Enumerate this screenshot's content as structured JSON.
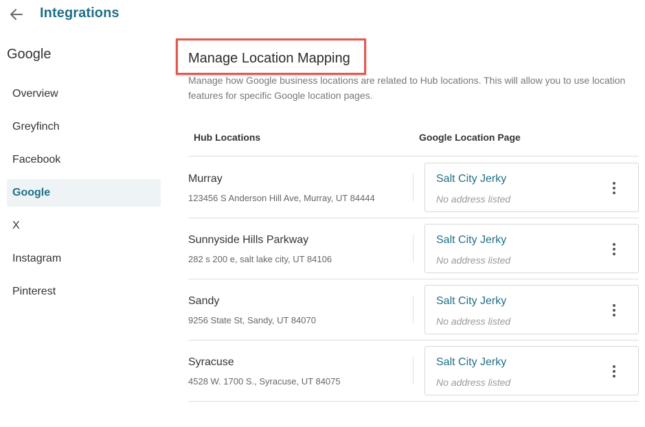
{
  "header": {
    "back_icon": "arrow-left-icon",
    "title": "Integrations"
  },
  "sidebar": {
    "heading": "Google",
    "items": [
      {
        "label": "Overview",
        "active": false
      },
      {
        "label": "Greyfinch",
        "active": false
      },
      {
        "label": "Facebook",
        "active": false
      },
      {
        "label": "Google",
        "active": true
      },
      {
        "label": "X",
        "active": false
      },
      {
        "label": "Instagram",
        "active": false
      },
      {
        "label": "Pinterest",
        "active": false
      }
    ]
  },
  "main": {
    "title": "Manage Location Mapping",
    "description": "Manage how Google business locations are related to Hub locations. This will allow you to use location features for specific Google location pages.",
    "columns": {
      "hub": "Hub Locations",
      "google": "Google Location Page"
    },
    "rows": [
      {
        "hub_name": "Murray",
        "hub_address": "123456 S Anderson Hill Ave, Murray, UT 84444",
        "google_name": "Salt City Jerky",
        "google_address": "No address listed"
      },
      {
        "hub_name": "Sunnyside Hills Parkway",
        "hub_address": "282 s 200 e, salt lake city, UT 84106",
        "google_name": "Salt City Jerky",
        "google_address": "No address listed"
      },
      {
        "hub_name": "Sandy",
        "hub_address": "9256 State St, Sandy, UT 84070",
        "google_name": "Salt City Jerky",
        "google_address": "No address listed"
      },
      {
        "hub_name": "Syracuse",
        "hub_address": "4528 W. 1700 S., Syracuse, UT 84075",
        "google_name": "Salt City Jerky",
        "google_address": "No address listed"
      }
    ]
  },
  "colors": {
    "accent": "#1f6f86",
    "highlight_border": "#e25a4e",
    "active_nav_bg": "#eef4f6"
  }
}
